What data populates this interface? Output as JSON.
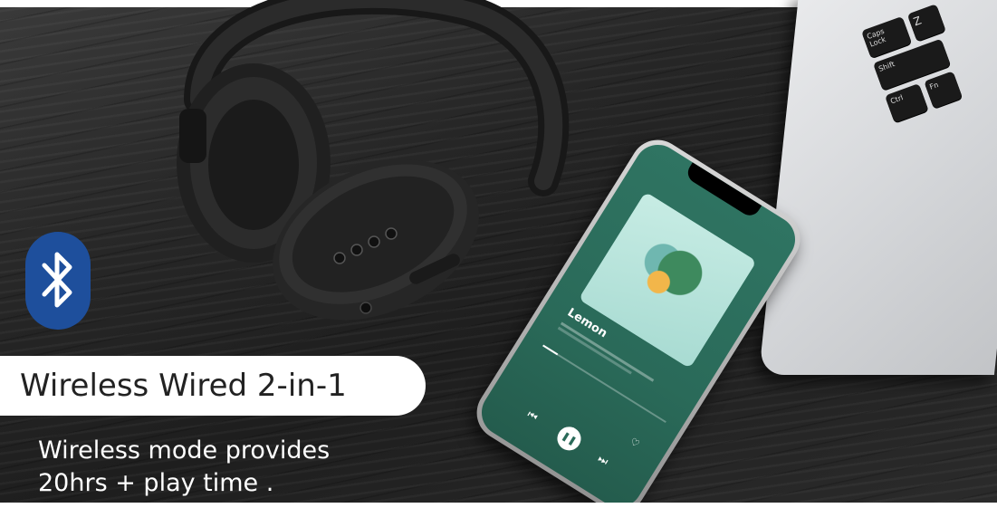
{
  "banner": {
    "headline": "Wireless Wired 2-in-1",
    "description_line1": "Wireless mode provides",
    "description_line2": "20hrs + play time ."
  },
  "phone": {
    "song_title": "Lemon",
    "album_tint": "#2a6a59"
  },
  "laptop": {
    "keys": [
      "Caps Lock",
      "Shift",
      "Ctrl",
      "Fn",
      "Z"
    ]
  },
  "icons": {
    "bluetooth": "bluetooth-icon",
    "play": "pause-icon",
    "prev": "previous-icon",
    "next": "next-icon"
  },
  "colors": {
    "bluetooth_blue": "#1e4f9c",
    "phone_green": "#2a6a59",
    "pill_bg": "#ffffff"
  }
}
